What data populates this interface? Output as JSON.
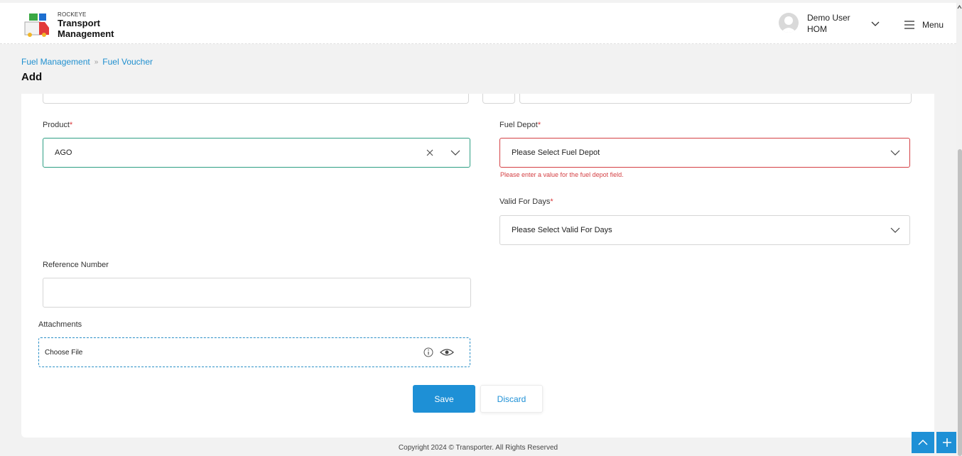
{
  "app": {
    "brand_small": "ROCKEYE",
    "brand_line1": "Transport",
    "brand_line2": "Management"
  },
  "user": {
    "name": "Demo User",
    "role": "HOM"
  },
  "menu": {
    "label": "Menu"
  },
  "breadcrumb": {
    "items": [
      "Fuel Management",
      "Fuel Voucher"
    ],
    "separator": "»"
  },
  "page": {
    "title": "Add"
  },
  "form": {
    "product": {
      "label": "Product",
      "required_mark": "*",
      "value": "AGO"
    },
    "fuel_depot": {
      "label": "Fuel Depot",
      "required_mark": "*",
      "placeholder": "Please Select Fuel Depot",
      "error": "Please enter a value for the fuel depot field."
    },
    "valid_for_days": {
      "label": "Valid For Days",
      "required_mark": "*",
      "placeholder": "Please Select Valid For Days"
    },
    "reference_number": {
      "label": "Reference Number",
      "value": ""
    },
    "attachments": {
      "label": "Attachments",
      "choose_file": "Choose File"
    }
  },
  "actions": {
    "save": "Save",
    "discard": "Discard"
  },
  "footer": {
    "copyright": "Copyright 2024 © Transporter. All Rights Reserved"
  },
  "colors": {
    "accent": "#1e90d6",
    "success_border": "#2e9f84",
    "error": "#d44044",
    "link": "#1f8fcf"
  }
}
